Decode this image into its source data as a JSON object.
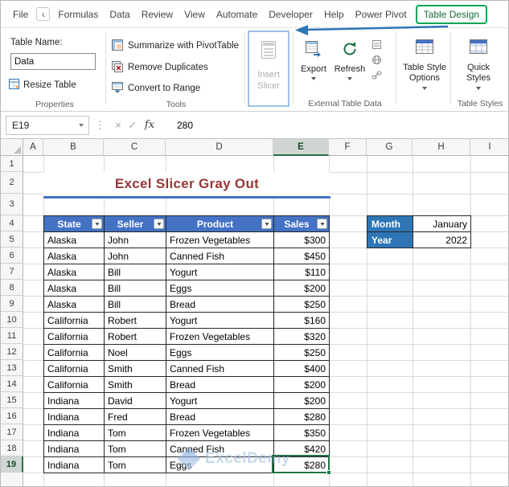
{
  "colors": {
    "active_tab_green": "#00A651",
    "selection_green": "#217346",
    "table_header_blue": "#4472C4",
    "side_label_blue": "#2E75B6",
    "title_red": "#953735",
    "underline_blue": "#4472C4",
    "annotation_arrow_blue": "#2E75B6",
    "slicer_highlight_blue": "#9DC3E6"
  },
  "icons": {
    "back_chevron": "‹",
    "divider_dots": "⋮"
  },
  "ribbon": {
    "tabs": [
      "File",
      "Formulas",
      "Data",
      "Review",
      "View",
      "Automate",
      "Developer",
      "Help",
      "Power Pivot",
      "Table Design"
    ],
    "active_tab": "Table Design",
    "properties_group": {
      "table_name_label": "Table Name:",
      "table_name_value": "Data",
      "resize_label": "Resize Table",
      "group_label": "Properties"
    },
    "tools_group": {
      "items": [
        "Summarize with PivotTable",
        "Remove Duplicates",
        "Convert to Range"
      ],
      "group_label": "Tools"
    },
    "insert_slicer_label": "Insert Slicer",
    "external_group": {
      "export_label": "Export",
      "refresh_label": "Refresh",
      "group_label": "External Table Data"
    },
    "styles_group": {
      "options_label": "Table Style Options",
      "quick_label": "Quick Styles",
      "group_label": "Table Styles"
    }
  },
  "formula_bar": {
    "name_box": "E19",
    "cancel": "×",
    "enter": "✓",
    "fx": "fx",
    "value": "280"
  },
  "grid": {
    "columns": [
      "A",
      "B",
      "C",
      "D",
      "E",
      "F",
      "G",
      "H",
      "I"
    ],
    "row_numbers": [
      "1",
      "2",
      "3",
      "4",
      "5",
      "6",
      "7",
      "8",
      "9",
      "10",
      "11",
      "12",
      "13",
      "14",
      "15",
      "16",
      "17",
      "18",
      "19",
      ""
    ],
    "selected_column": "E",
    "selected_row": "19",
    "selected_cell": "E19"
  },
  "sheet": {
    "title": "Excel Slicer Gray Out",
    "table": {
      "headers": [
        "State",
        "Seller",
        "Product",
        "Sales"
      ],
      "rows": [
        [
          "Alaska",
          "John",
          "Frozen Vegetables",
          "$300"
        ],
        [
          "Alaska",
          "John",
          "Canned Fish",
          "$450"
        ],
        [
          "Alaska",
          "Bill",
          "Yogurt",
          "$110"
        ],
        [
          "Alaska",
          "Bill",
          "Eggs",
          "$200"
        ],
        [
          "Alaska",
          "Bill",
          "Bread",
          "$250"
        ],
        [
          "California",
          "Robert",
          "Yogurt",
          "$160"
        ],
        [
          "California",
          "Robert",
          "Frozen Vegetables",
          "$320"
        ],
        [
          "California",
          "Noel",
          "Eggs",
          "$250"
        ],
        [
          "California",
          "Smith",
          "Canned Fish",
          "$400"
        ],
        [
          "California",
          "Smith",
          "Bread",
          "$200"
        ],
        [
          "Indiana",
          "David",
          "Yogurt",
          "$200"
        ],
        [
          "Indiana",
          "Fred",
          "Bread",
          "$280"
        ],
        [
          "Indiana",
          "Tom",
          "Frozen Vegetables",
          "$350"
        ],
        [
          "Indiana",
          "Tom",
          "Canned Fish",
          "$420"
        ],
        [
          "Indiana",
          "Tom",
          "Eggs",
          "$280"
        ]
      ]
    },
    "side_table": {
      "rows": [
        [
          "Month",
          "January"
        ],
        [
          "Year",
          "2022"
        ]
      ]
    },
    "watermark": "ExcelDemy"
  }
}
